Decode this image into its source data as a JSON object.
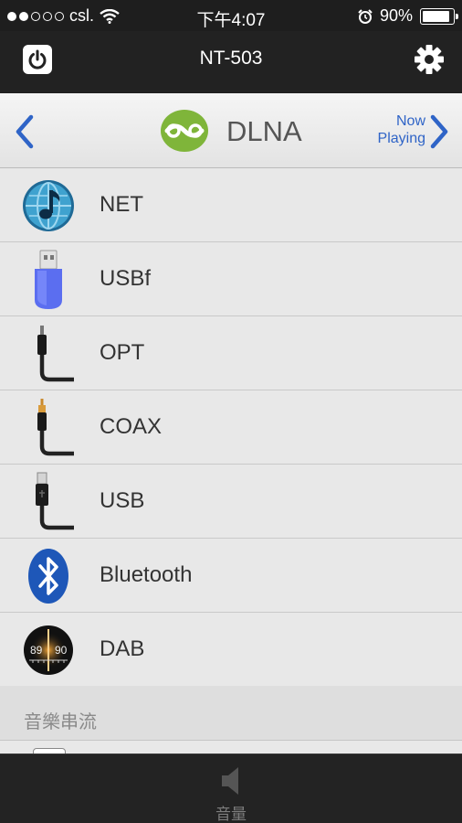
{
  "status_bar": {
    "carrier": "csl.",
    "time": "下午4:07",
    "battery_percent": "90%",
    "battery_level": 0.9,
    "signal_bars_filled": 2,
    "signal_bars_total": 5
  },
  "nav": {
    "title": "NT-503",
    "power_icon": "power-icon",
    "settings_icon": "gear-icon"
  },
  "current_source": {
    "name": "DLNA",
    "now_playing_line1": "Now",
    "now_playing_line2": "Playing"
  },
  "sources": [
    {
      "label": "NET",
      "icon": "net-globe-icon"
    },
    {
      "label": "USBf",
      "icon": "usb-flash-drive-icon"
    },
    {
      "label": "OPT",
      "icon": "optical-cable-icon"
    },
    {
      "label": "COAX",
      "icon": "coax-cable-icon"
    },
    {
      "label": "USB",
      "icon": "usb-cable-icon"
    },
    {
      "label": "Bluetooth",
      "icon": "bluetooth-icon"
    },
    {
      "label": "DAB",
      "icon": "dab-radio-icon"
    }
  ],
  "section": {
    "streaming_label": "音樂串流"
  },
  "bottom_bar": {
    "volume_label": "音量"
  },
  "colors": {
    "accent_blue": "#2f64c7",
    "dlna_green": "#7fb53a",
    "bluetooth_blue": "#1e57b8"
  }
}
